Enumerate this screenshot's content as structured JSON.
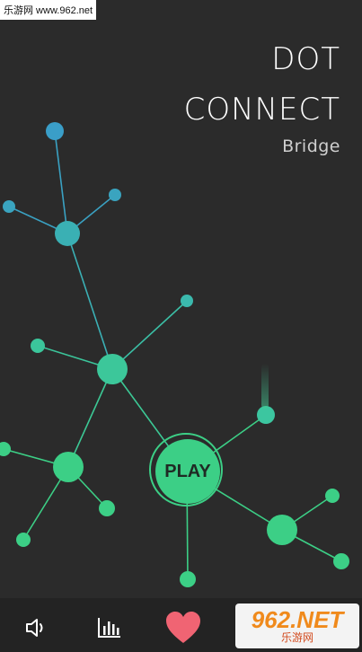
{
  "watermark": {
    "top_text": "乐游网 www.962.net",
    "logo_number": "962.NET",
    "logo_caption": "乐游网"
  },
  "title": {
    "line1": "DOT",
    "line2": "CONNECT",
    "subtitle": "Bridge"
  },
  "play": {
    "label": "PLAY"
  },
  "bottom_bar": {
    "sound_icon": "speaker-icon",
    "stats_icon": "bar-chart-icon",
    "like_icon": "heart-icon"
  },
  "colors": {
    "background": "#2b2b2b",
    "blue_node": "#3aa1c2",
    "teal_node": "#3bbfa6",
    "green_node": "#3ccf86",
    "heart": "#f06473"
  }
}
